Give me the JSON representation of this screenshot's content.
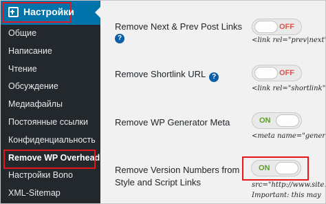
{
  "sidebar": {
    "header": {
      "title": "Настройки",
      "icon": "settings-plus-icon"
    },
    "items": [
      {
        "label": "Общие"
      },
      {
        "label": "Написание"
      },
      {
        "label": "Чтение"
      },
      {
        "label": "Обсуждение"
      },
      {
        "label": "Медиафайлы"
      },
      {
        "label": "Постоянные ссылки"
      },
      {
        "label": "Конфиденциальность"
      },
      {
        "label": "Remove WP Overhead",
        "active": true
      },
      {
        "label": "Настройки Bono"
      },
      {
        "label": "XML-Sitemap"
      }
    ]
  },
  "settings": [
    {
      "label": "Remove Next & Prev Post Links",
      "help": "?",
      "toggle": "OFF",
      "code": "<link rel=\"prev|next\""
    },
    {
      "label": "Remove Shortlink URL",
      "help": "?",
      "toggle": "OFF",
      "code": "<link rel=\"shortlink\""
    },
    {
      "label": "Remove WP Generator Meta",
      "toggle": "ON",
      "code": "<meta name=\"generator\""
    },
    {
      "label_line1": "Remove Version Numbers from",
      "label_line2": "Style and Script Links",
      "toggle": "ON",
      "code_line1": "src=\"http://www.site.com",
      "code_line2": "Important: this may"
    }
  ],
  "colors": {
    "sidebar_bg": "#23282d",
    "header_bg": "#0073aa",
    "highlight": "#e8141b",
    "toggle_off": "#d9534f",
    "toggle_on": "#5a9e27",
    "help_icon": "#0a5fa6"
  }
}
